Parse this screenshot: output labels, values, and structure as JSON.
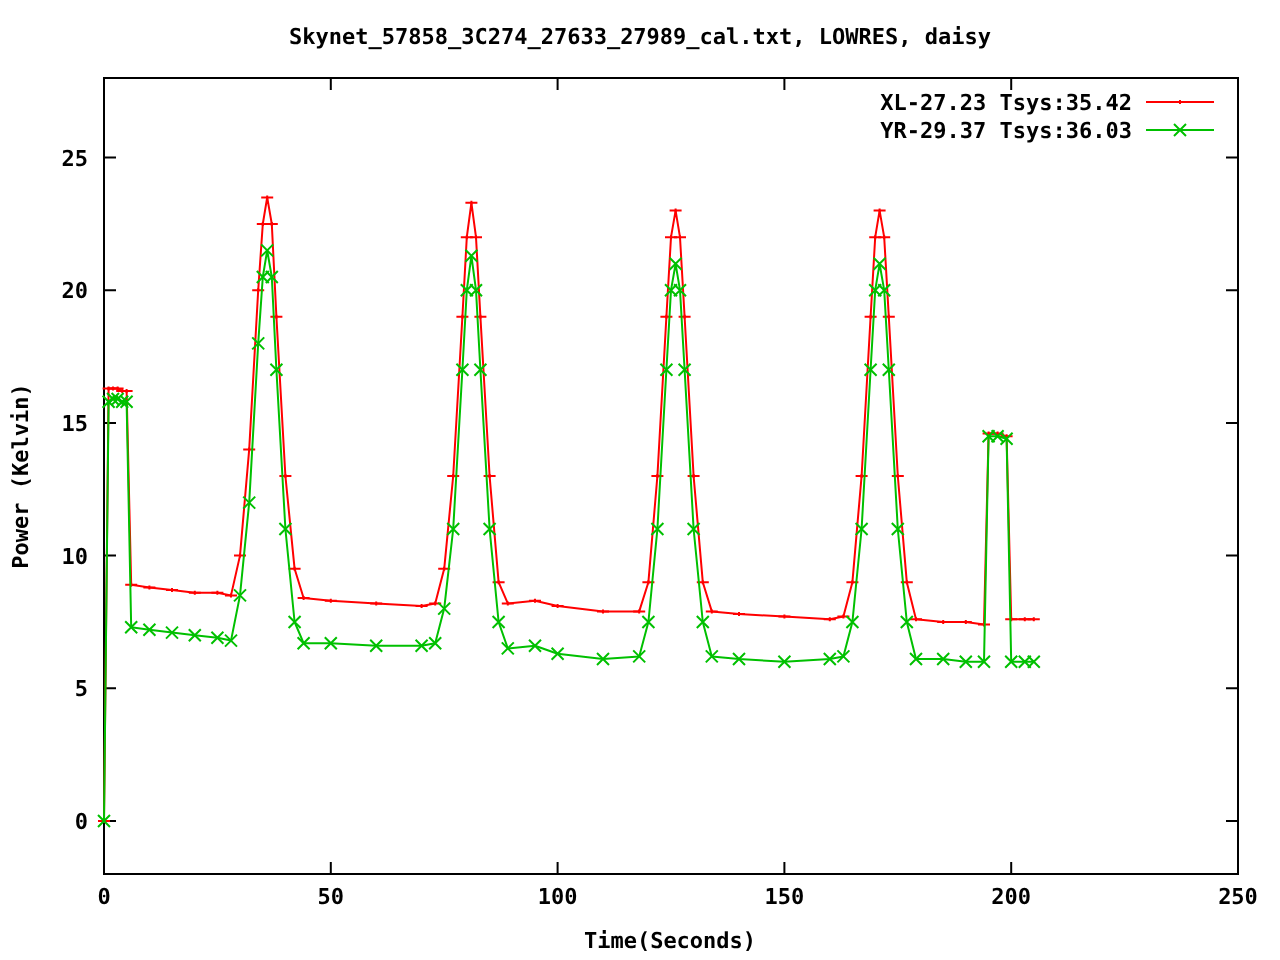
{
  "chart_data": {
    "type": "line",
    "title": "Skynet_57858_3C274_27633_27989_cal.txt, LOWRES, daisy",
    "xlabel": "Time(Seconds)",
    "ylabel": "Power (Kelvin)",
    "x": [
      0,
      1,
      2,
      3,
      4,
      5,
      6,
      10,
      15,
      20,
      25,
      28,
      30,
      32,
      34,
      35,
      36,
      37,
      38,
      40,
      42,
      44,
      50,
      60,
      70,
      73,
      75,
      77,
      79,
      80,
      81,
      82,
      83,
      85,
      87,
      89,
      95,
      100,
      110,
      118,
      120,
      122,
      124,
      125,
      126,
      127,
      128,
      130,
      132,
      134,
      140,
      150,
      160,
      163,
      165,
      167,
      169,
      170,
      171,
      172,
      173,
      175,
      177,
      179,
      185,
      190,
      194,
      195,
      197,
      199,
      200,
      203,
      205
    ],
    "series": [
      {
        "name": "XL-27.23 Tsys:35.42",
        "color": "#ff0000",
        "values": [
          0,
          16.3,
          16.3,
          16.3,
          16.2,
          16.2,
          8.9,
          8.8,
          8.7,
          8.6,
          8.6,
          8.5,
          10,
          14,
          20,
          22.5,
          23.5,
          22.5,
          19,
          13,
          9.5,
          8.4,
          8.3,
          8.2,
          8.1,
          8.2,
          9.5,
          13,
          19,
          22,
          23.3,
          22,
          19,
          13,
          9,
          8.2,
          8.3,
          8.1,
          7.9,
          7.9,
          9,
          13,
          19,
          22,
          23,
          22,
          19,
          13,
          9,
          7.9,
          7.8,
          7.7,
          7.6,
          7.7,
          9,
          13,
          19,
          22,
          23,
          22,
          19,
          13,
          9,
          7.6,
          7.5,
          7.5,
          7.4,
          14.6,
          14.6,
          14.5,
          7.6,
          7.6,
          7.6
        ]
      },
      {
        "name": "YR-29.37 Tsys:36.03",
        "color": "#00c000",
        "values": [
          0,
          15.8,
          15.9,
          15.9,
          15.8,
          15.8,
          7.3,
          7.2,
          7.1,
          7.0,
          6.9,
          6.8,
          8.5,
          12,
          18,
          20.5,
          21.5,
          20.5,
          17,
          11,
          7.5,
          6.7,
          6.7,
          6.6,
          6.6,
          6.7,
          8,
          11,
          17,
          20,
          21.3,
          20,
          17,
          11,
          7.5,
          6.5,
          6.6,
          6.3,
          6.1,
          6.2,
          7.5,
          11,
          17,
          20,
          21,
          20,
          17,
          11,
          7.5,
          6.2,
          6.1,
          6.0,
          6.1,
          6.2,
          7.5,
          11,
          17,
          20,
          21,
          20,
          17,
          11,
          7.5,
          6.1,
          6.1,
          6.0,
          6.0,
          14.5,
          14.5,
          14.4,
          6.0,
          6.0,
          6.0
        ]
      }
    ],
    "xlim": [
      0,
      250
    ],
    "ylim": [
      -2,
      28
    ],
    "xticks": [
      0,
      50,
      100,
      150,
      200,
      250
    ],
    "yticks": [
      0,
      5,
      10,
      15,
      20,
      25
    ],
    "legend": true
  }
}
